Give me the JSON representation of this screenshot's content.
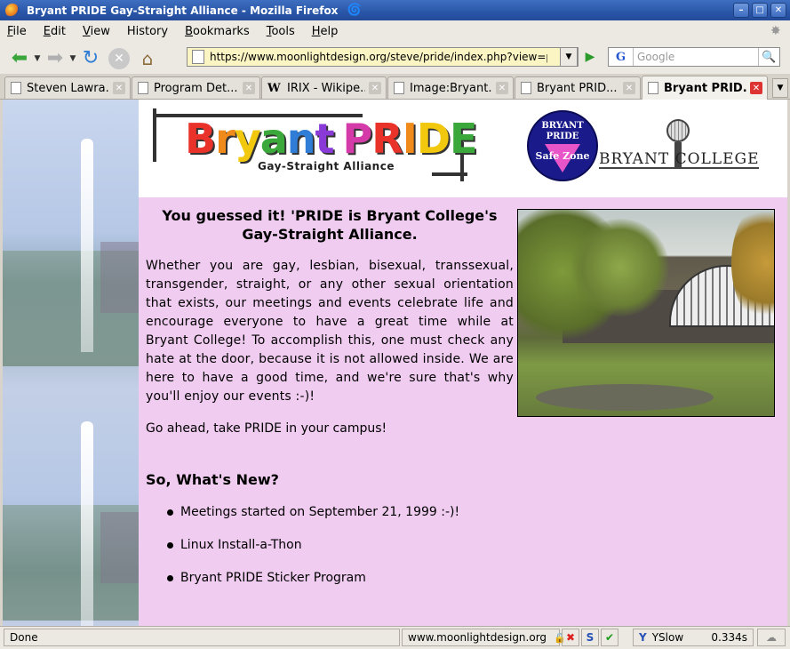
{
  "window": {
    "title": "Bryant PRIDE Gay-Straight Alliance - Mozilla Firefox"
  },
  "menubar": {
    "items": [
      {
        "label": "File",
        "key": "F",
        "rest": "ile"
      },
      {
        "label": "Edit",
        "key": "E",
        "rest": "dit"
      },
      {
        "label": "View",
        "key": "V",
        "rest": "iew"
      },
      {
        "label": "History",
        "key": "",
        "rest": "History"
      },
      {
        "label": "Bookmarks",
        "key": "B",
        "rest": "ookmarks"
      },
      {
        "label": "Tools",
        "key": "T",
        "rest": "ools"
      },
      {
        "label": "Help",
        "key": "H",
        "rest": "elp"
      }
    ]
  },
  "navbar": {
    "url": "https://www.moonlightdesign.org/steve/pride/index.php?view=pec",
    "search_placeholder": "Google",
    "search_engine": "G"
  },
  "tabs": [
    {
      "label": "Steven Lawra...",
      "icon": "page-icon",
      "active": false
    },
    {
      "label": "Program Det...",
      "icon": "page-icon",
      "active": false
    },
    {
      "label": "IRIX - Wikipe...",
      "icon": "wikipedia-icon",
      "active": false
    },
    {
      "label": "Image:Bryant...",
      "icon": "page-icon",
      "active": false
    },
    {
      "label": "Bryant PRID...",
      "icon": "page-icon",
      "active": false
    },
    {
      "label": "Bryant PRID...",
      "icon": "page-icon",
      "active": true
    }
  ],
  "page": {
    "logo": {
      "word1": "Bryant",
      "word2": "PRIDE",
      "subtitle": "Gay-Straight Alliance"
    },
    "seal": {
      "line1": "BRYANT",
      "line2": "PRIDE",
      "safe_zone": "Safe Zone"
    },
    "college_name": "BRYANT COLLEGE",
    "headline": "You guessed it!  'PRIDE is Bryant College's Gay-Straight Alliance.",
    "intro": "Whether you are gay, lesbian, bisexual, transsexual, transgender, straight, or any other sexual orientation that exists, our meetings and events celebrate life and encourage everyone to have a great time while at Bryant College!  To accomplish this, one must check any hate at the door, because it is not allowed inside.  We are here to have a good time, and we're sure that's why you'll enjoy our events :-)!",
    "closing": "Go ahead, take PRIDE in your campus!",
    "whats_new_title": "So, What's New?",
    "news": [
      "Meetings started on September 21, 1999 :-)!",
      "Linux Install-a-Thon",
      "Bryant PRIDE Sticker Program"
    ]
  },
  "statusbar": {
    "status": "Done",
    "host": "www.moonlightdesign.org",
    "yslow_label": "YSlow",
    "yslow_time": "0.334s"
  },
  "colors": {
    "content_bg": "#f0ccf0",
    "titlebar": "#2a56a8",
    "logo_letters": [
      "#e8322a",
      "#f08a1a",
      "#f2c80f",
      "#3aa83a",
      "#2f7dd6",
      "#8a3ad6",
      "#d43aa8"
    ]
  }
}
